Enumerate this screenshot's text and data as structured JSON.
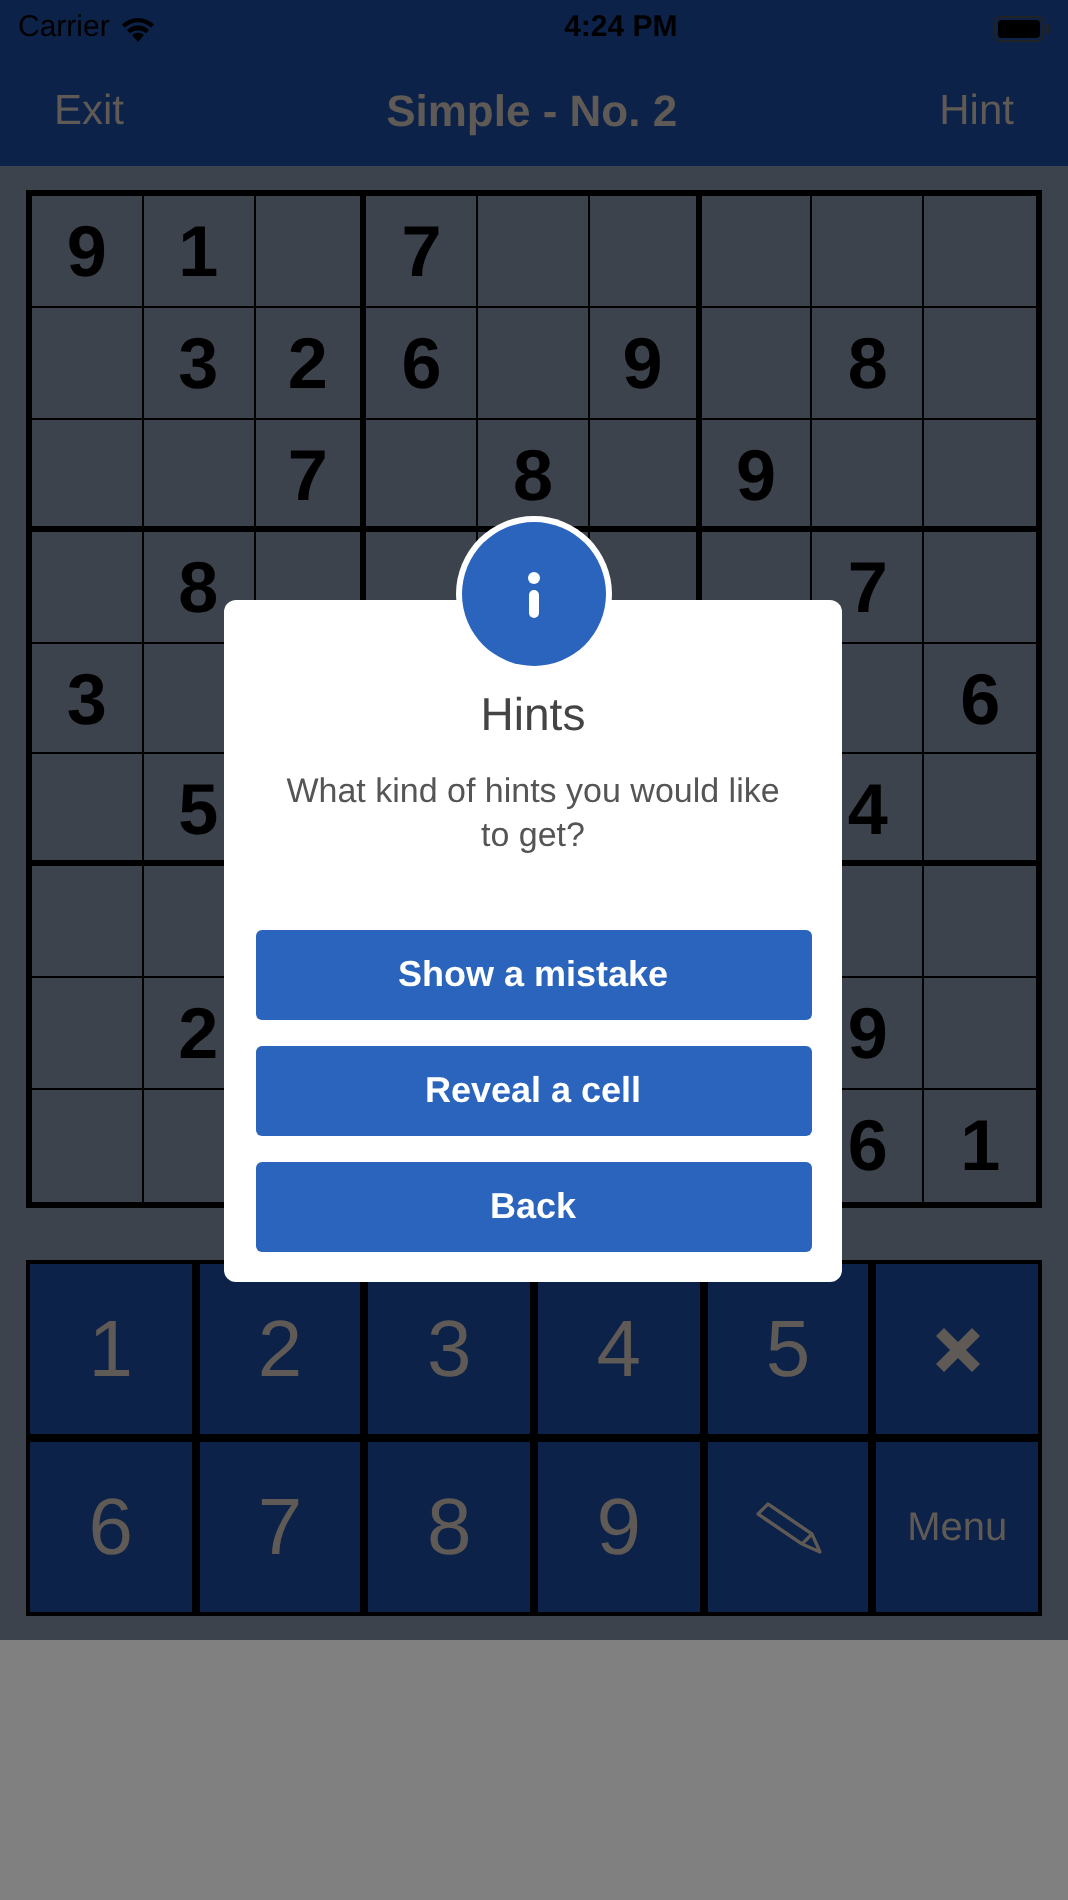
{
  "status_bar": {
    "carrier": "Carrier",
    "time": "4:24 PM"
  },
  "nav": {
    "left": "Exit",
    "title": "Simple - No. 2",
    "right": "Hint"
  },
  "board": {
    "rows": [
      [
        "9",
        "1",
        null,
        "7",
        null,
        null,
        null,
        null,
        null
      ],
      [
        null,
        "3",
        "2",
        "6",
        null,
        "9",
        null,
        "8",
        null
      ],
      [
        null,
        null,
        "7",
        null,
        "8",
        null,
        "9",
        null,
        null
      ],
      [
        null,
        "8",
        null,
        null,
        null,
        null,
        null,
        "7",
        null
      ],
      [
        "3",
        null,
        null,
        null,
        null,
        null,
        null,
        null,
        "6"
      ],
      [
        null,
        "5",
        null,
        null,
        null,
        null,
        null,
        "4",
        null
      ],
      [
        null,
        null,
        null,
        null,
        null,
        null,
        null,
        null,
        null
      ],
      [
        null,
        "2",
        null,
        null,
        null,
        null,
        null,
        "9",
        null
      ],
      [
        null,
        null,
        null,
        null,
        null,
        null,
        null,
        "6",
        "1"
      ]
    ]
  },
  "keypad": [
    {
      "kind": "digit",
      "label": "1"
    },
    {
      "kind": "digit",
      "label": "2"
    },
    {
      "kind": "digit",
      "label": "3"
    },
    {
      "kind": "digit",
      "label": "4"
    },
    {
      "kind": "digit",
      "label": "5"
    },
    {
      "kind": "erase"
    },
    {
      "kind": "digit",
      "label": "6"
    },
    {
      "kind": "digit",
      "label": "7"
    },
    {
      "kind": "digit",
      "label": "8"
    },
    {
      "kind": "digit",
      "label": "9"
    },
    {
      "kind": "pencil"
    },
    {
      "kind": "text",
      "label": "Menu"
    }
  ],
  "dialog": {
    "title": "Hints",
    "message": "What kind of hints you would like to get?",
    "buttons": [
      "Show a mistake",
      "Reveal a cell",
      "Back"
    ]
  }
}
